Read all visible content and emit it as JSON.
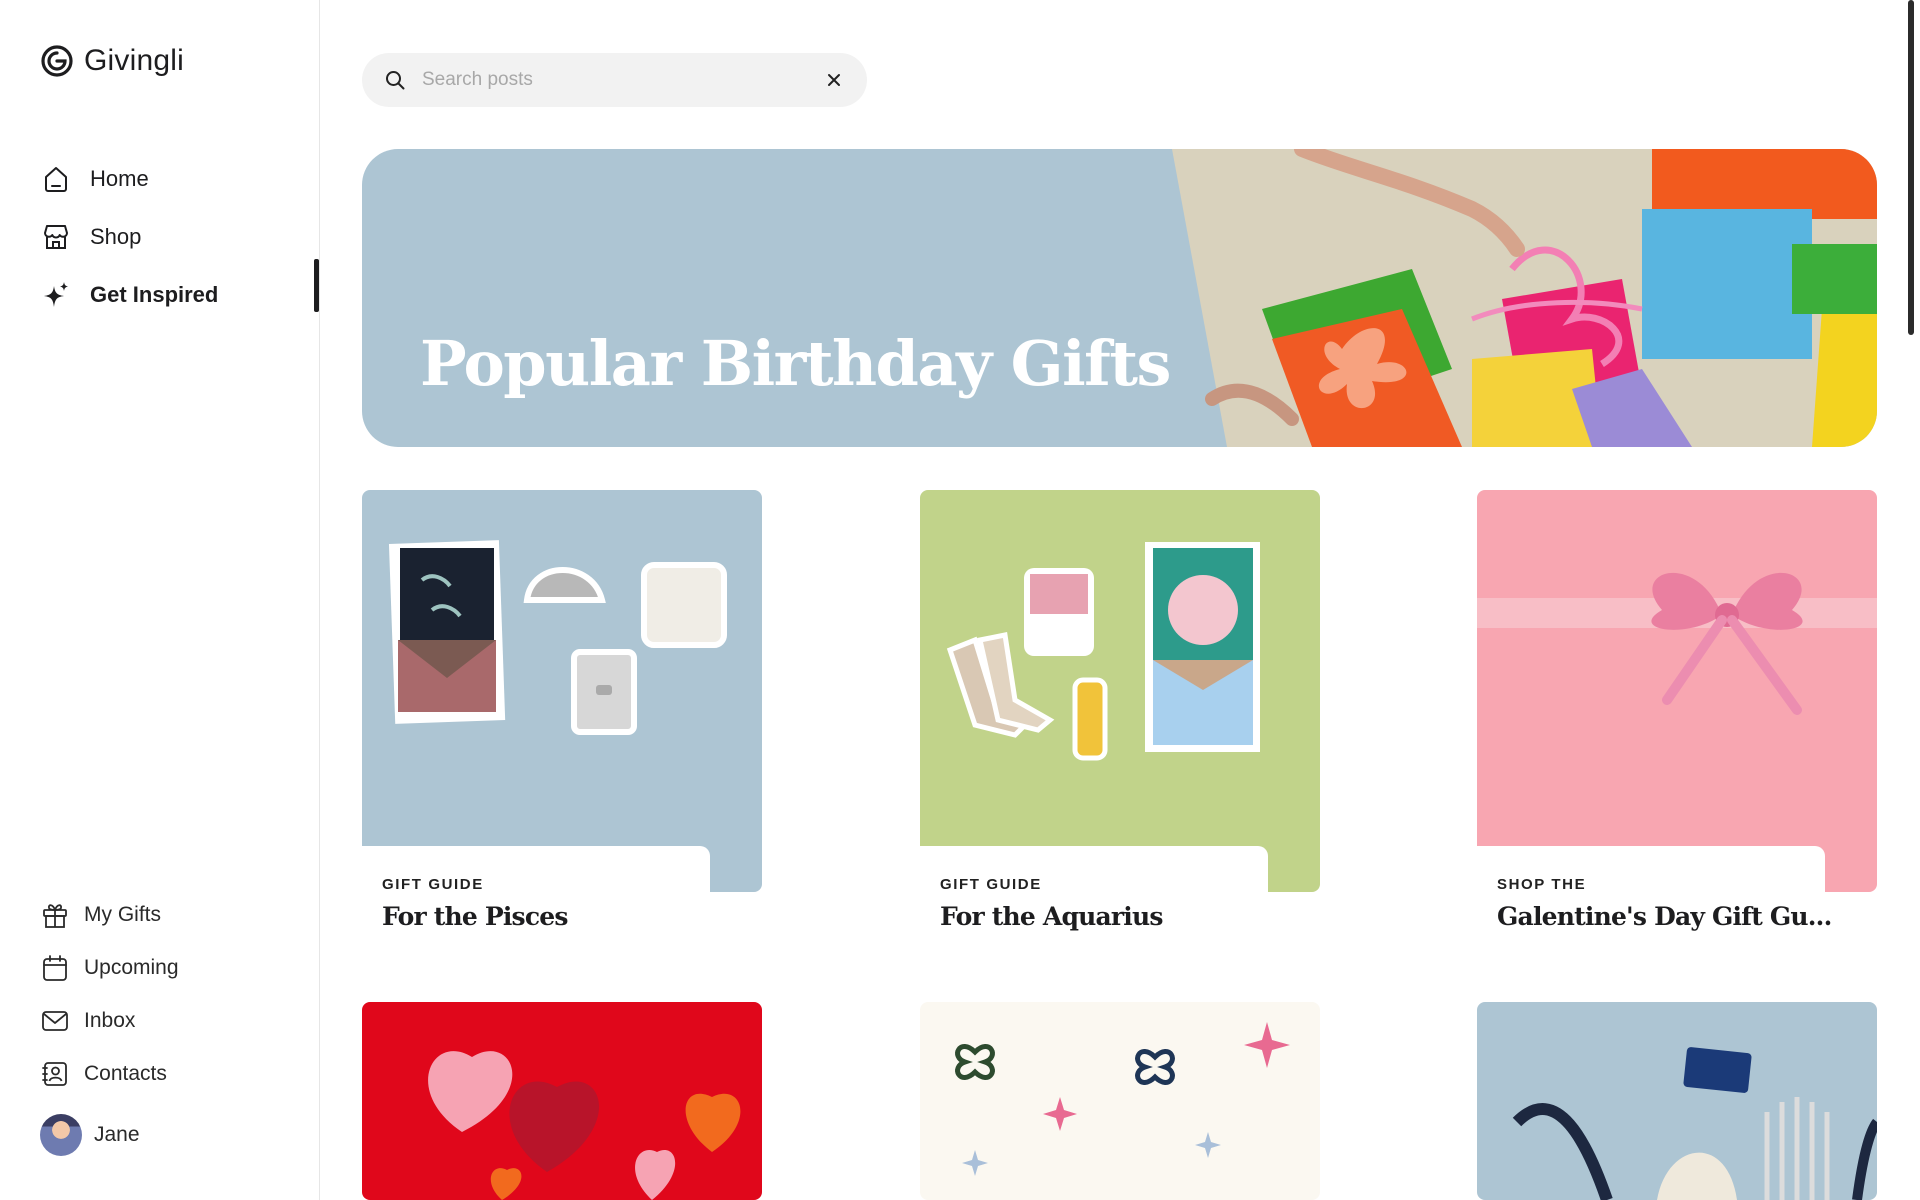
{
  "brand": {
    "name": "Givingli"
  },
  "nav": {
    "primary": [
      {
        "label": "Home",
        "icon": "home-icon"
      },
      {
        "label": "Shop",
        "icon": "shop-icon"
      },
      {
        "label": "Get Inspired",
        "icon": "sparkle-icon",
        "active": true
      }
    ],
    "secondary": [
      {
        "label": "My Gifts",
        "icon": "gift-icon"
      },
      {
        "label": "Upcoming",
        "icon": "calendar-icon"
      },
      {
        "label": "Inbox",
        "icon": "mail-icon"
      },
      {
        "label": "Contacts",
        "icon": "contacts-icon"
      }
    ],
    "user": {
      "name": "Jane"
    }
  },
  "search": {
    "placeholder": "Search posts",
    "value": ""
  },
  "hero": {
    "title": "Popular Birthday Gifts"
  },
  "cards": [
    {
      "kicker": "GIFT GUIDE",
      "title": "For the Pisces",
      "bg": "#adc5d3"
    },
    {
      "kicker": "GIFT GUIDE",
      "title": "For the Aquarius",
      "bg": "#c1d38a"
    },
    {
      "kicker": "SHOP THE",
      "title": "Galentine's Day Gift Gu...",
      "bg": "#f8a6b1"
    },
    {
      "kicker": "",
      "title": "",
      "bg": "#e0071b"
    },
    {
      "kicker": "",
      "title": "",
      "bg": "#fbf8f1"
    },
    {
      "kicker": "",
      "title": "",
      "bg": "#adc5d3"
    }
  ],
  "colors": {
    "accent": "#1d1d1f",
    "sidebar_border": "#e6e6e6"
  }
}
